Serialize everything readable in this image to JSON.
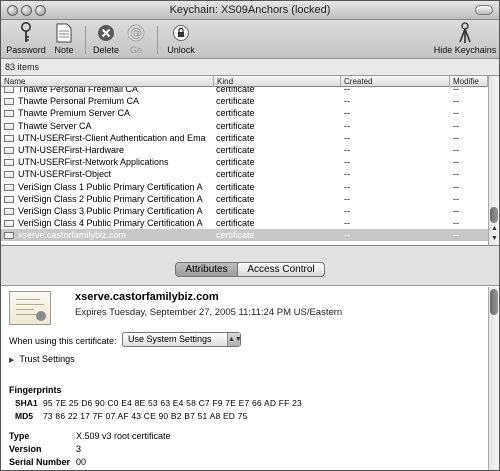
{
  "window": {
    "title": "Keychain: XS09Anchors (locked)"
  },
  "toolbar": {
    "password": "Password",
    "note": "Note",
    "delete": "Delete",
    "go": "Go",
    "unlock": "Unlock",
    "hide_keychains": "Hide Keychains"
  },
  "list": {
    "count": "83 items",
    "columns": {
      "name": "Name",
      "kind": "Kind",
      "created": "Created",
      "modified": "Modifie"
    },
    "rows": [
      {
        "name": "Thawte Personal Freemail CA",
        "kind": "certificate",
        "created": "--",
        "modified": "--"
      },
      {
        "name": "Thawte Personal Premium CA",
        "kind": "certificate",
        "created": "--",
        "modified": "--"
      },
      {
        "name": "Thawte Premium Server CA",
        "kind": "certificate",
        "created": "--",
        "modified": "--"
      },
      {
        "name": "Thawte Server CA",
        "kind": "certificate",
        "created": "--",
        "modified": "--"
      },
      {
        "name": "UTN-USERFirst-Client Authentication and Ema",
        "kind": "certificate",
        "created": "--",
        "modified": "--"
      },
      {
        "name": "UTN-USERFirst-Hardware",
        "kind": "certificate",
        "created": "--",
        "modified": "--"
      },
      {
        "name": "UTN-USERFirst-Network Applications",
        "kind": "certificate",
        "created": "--",
        "modified": "--"
      },
      {
        "name": "UTN-USERFirst-Object",
        "kind": "certificate",
        "created": "--",
        "modified": "--"
      },
      {
        "name": "VeriSign Class 1 Public Primary Certification A",
        "kind": "certificate",
        "created": "--",
        "modified": "--"
      },
      {
        "name": "VeriSign Class 2 Public Primary Certification A",
        "kind": "certificate",
        "created": "--",
        "modified": "--"
      },
      {
        "name": "VeriSign Class 3 Public Primary Certification A",
        "kind": "certificate",
        "created": "--",
        "modified": "--"
      },
      {
        "name": "VeriSign Class 4 Public Primary Certification A",
        "kind": "certificate",
        "created": "--",
        "modified": "--"
      },
      {
        "name": "xserve.castorfamilybiz.com",
        "kind": "certificate",
        "created": "--",
        "modified": "--"
      }
    ]
  },
  "tabs": {
    "attributes": "Attributes",
    "access_control": "Access Control"
  },
  "detail": {
    "name": "xserve.castorfamilybiz.com",
    "expires": "Expires Tuesday, September 27, 2005 11:11:24 PM US/Eastern",
    "when_label": "When using this certificate:",
    "when_value": "Use System Settings",
    "trust_settings": "Trust Settings",
    "fingerprints_title": "Fingerprints",
    "sha1_label": "SHA1",
    "sha1_value": "95 7E 25 D6 90 C0 E4 8E 53 63 E4 58 C7 F9 7E E7 66 AD FF 23",
    "md5_label": "MD5",
    "md5_value": "73 86 22 17 7F 07 AF 43 CE 90 B2 B7 51 A8 ED 75",
    "type_label": "Type",
    "type_value": "X.509 v3 root certificate",
    "version_label": "Version",
    "version_value": "3",
    "serial_label": "Serial Number",
    "serial_value": "00"
  }
}
